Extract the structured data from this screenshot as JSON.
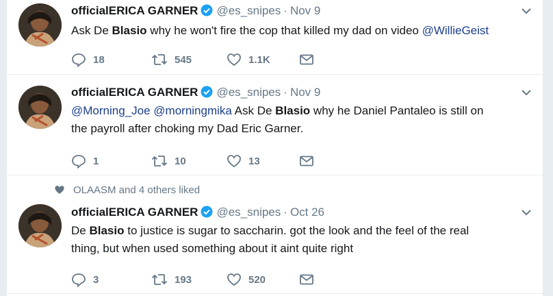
{
  "tweets": [
    {
      "name": "officialERICA GARNER",
      "handle": "@es_snipes",
      "separator": "·",
      "date": "Nov 9",
      "text_parts": {
        "a": "Ask De ",
        "b": "Blasio",
        "c": " why he won't fire the cop that killed my dad on video ",
        "mention": "@WillieGeist"
      },
      "replies": "18",
      "retweets": "545",
      "likes": "1.1K"
    },
    {
      "name": "officialERICA GARNER",
      "handle": "@es_snipes",
      "separator": "·",
      "date": "Nov 9",
      "text_parts": {
        "mention1": "@Morning_Joe",
        "mention2": "@morningmika",
        "a": " Ask De ",
        "b": "Blasio",
        "c": " why he Daniel Pantaleo is still on",
        "line2": "the payroll after choking my Dad Eric Garner."
      },
      "replies": "1",
      "retweets": "10",
      "likes": "13"
    },
    {
      "social_context": "OLAASM and 4 others liked",
      "name": "officialERICA GARNER",
      "handle": "@es_snipes",
      "separator": "·",
      "date": "Oct 26",
      "text_parts": {
        "a": "De ",
        "b": "Blasio",
        "c": " to justice is sugar to saccharin. got the look and the feel of the real",
        "line2": "thing, but when used something about it aint quite right"
      },
      "replies": "3",
      "retweets": "193",
      "likes": "520"
    }
  ],
  "colors": {
    "text": "#14171a",
    "secondary": "#657786",
    "mention": "#1b3f8b",
    "verified": "#1da1f2",
    "divider": "#e6ecf0"
  },
  "icons": [
    "reply-icon",
    "retweet-icon",
    "like-icon",
    "dm-icon",
    "chevron-down-icon",
    "verified-badge-icon",
    "heart-filled-icon"
  ]
}
